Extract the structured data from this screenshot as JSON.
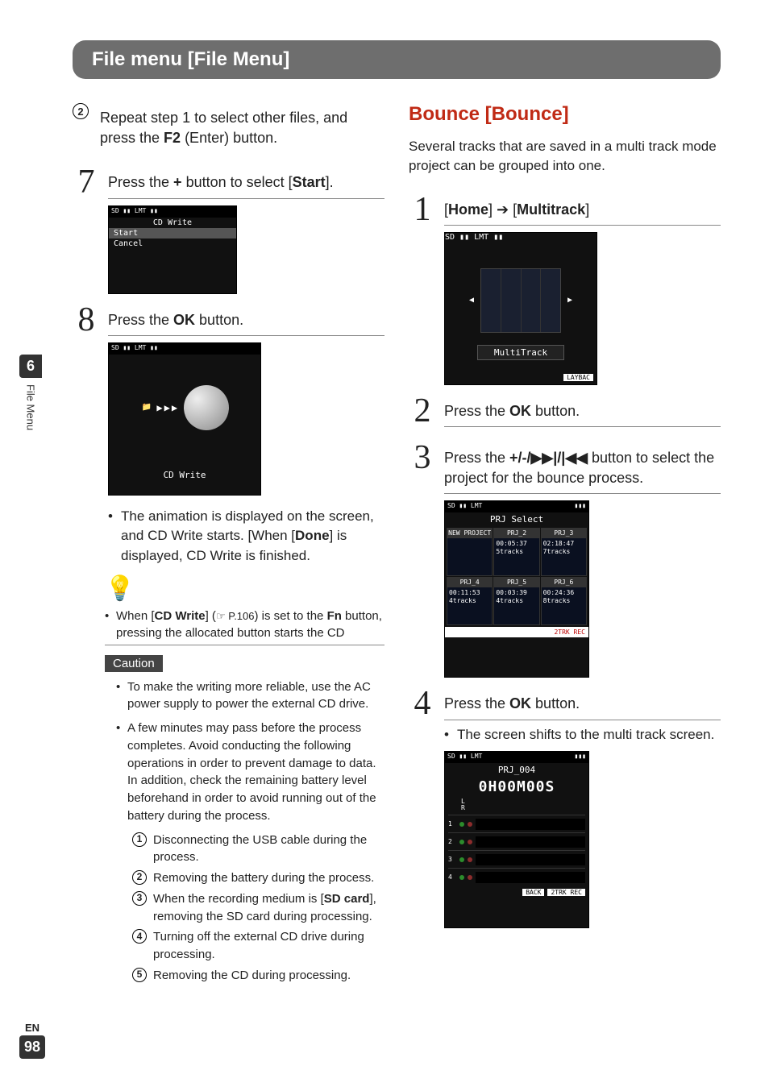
{
  "header": {
    "title": "File menu [File Menu]"
  },
  "side": {
    "chapter": "6",
    "section": "File Menu",
    "lang": "EN",
    "page": "98"
  },
  "left": {
    "step2_pre": {
      "num": "2",
      "text_a": "Repeat step 1 to select other files, and press the ",
      "btn": "F2",
      "text_b": " (Enter) button."
    },
    "step7": {
      "num": "7",
      "text_a": "Press the ",
      "btn": "+",
      "text_b": " button to select [",
      "target": "Start",
      "text_c": "]."
    },
    "screen7": {
      "title": "CD Write",
      "item1": "Start",
      "item2": "Cancel"
    },
    "step8": {
      "num": "8",
      "text_a": "Press the ",
      "btn": "OK",
      "text_b": " button."
    },
    "screen8": {
      "label": "CD Write"
    },
    "anim_a": "The animation is displayed on the screen, and CD Write starts. [When [",
    "anim_done": "Done",
    "anim_b": "] is displayed, CD Write is finished.",
    "tip_a": "When [",
    "tip_cd": "CD Write",
    "tip_b": "] (",
    "tip_ref": "☞ P.106",
    "tip_c": ") is set to the ",
    "tip_fn": "Fn",
    "tip_d": " button, pressing the allocated button starts the CD",
    "caution_label": "Caution",
    "caution1": "To make the writing more reliable, use the AC power supply to power the external CD drive.",
    "caution2": "A few minutes may pass before the process completes. Avoid conducting the following operations in order to prevent damage to data. In addition, check the remaining battery level beforehand in order to avoid running out of the battery during the process.",
    "op1": "Disconnecting the USB cable during the process.",
    "op2": "Removing the battery during the process.",
    "op3_a": "When the recording medium is [",
    "op3_sd": "SD card",
    "op3_b": "], removing the SD card during processing.",
    "op4": "Turning off the external CD drive during processing.",
    "op5": "Removing the CD during processing."
  },
  "right": {
    "title": "Bounce [Bounce]",
    "intro": "Several tracks that are saved in a multi track mode project can be grouped into one.",
    "step1": {
      "num": "1",
      "home": "Home",
      "arrow": "➔",
      "multi": "Multitrack"
    },
    "screen1": {
      "label": "MultiTrack",
      "foot": "LAYBAC"
    },
    "step2": {
      "num": "2",
      "text_a": "Press the ",
      "btn": "OK",
      "text_b": " button."
    },
    "step3": {
      "num": "3",
      "text_a": "Press the ",
      "btns": "+/-/▶▶|/|◀◀",
      "text_b": " button to select the project for the bounce process."
    },
    "screen3": {
      "title": "PRJ Select",
      "cells": [
        {
          "name": "NEW PROJECT",
          "l1": "",
          "l2": ""
        },
        {
          "name": "PRJ_2",
          "l1": "00:05:37",
          "l2": "5tracks"
        },
        {
          "name": "PRJ_3",
          "l1": "02:18:47",
          "l2": "7tracks"
        },
        {
          "name": "PRJ_4",
          "l1": "00:11:53",
          "l2": "4tracks"
        },
        {
          "name": "PRJ_5",
          "l1": "00:03:39",
          "l2": "4tracks"
        },
        {
          "name": "PRJ_6",
          "l1": "00:24:36",
          "l2": "8tracks"
        }
      ],
      "foot": "2TRK REC"
    },
    "step4": {
      "num": "4",
      "text_a": "Press the ",
      "btn": "OK",
      "text_b": " button."
    },
    "step4_bullet": "The screen shifts to the multi track screen.",
    "screen4": {
      "title": "PRJ_004",
      "time": "0H00M00S",
      "lr": "L\nR",
      "foot1": "BACK",
      "foot2": "2TRK REC"
    }
  }
}
